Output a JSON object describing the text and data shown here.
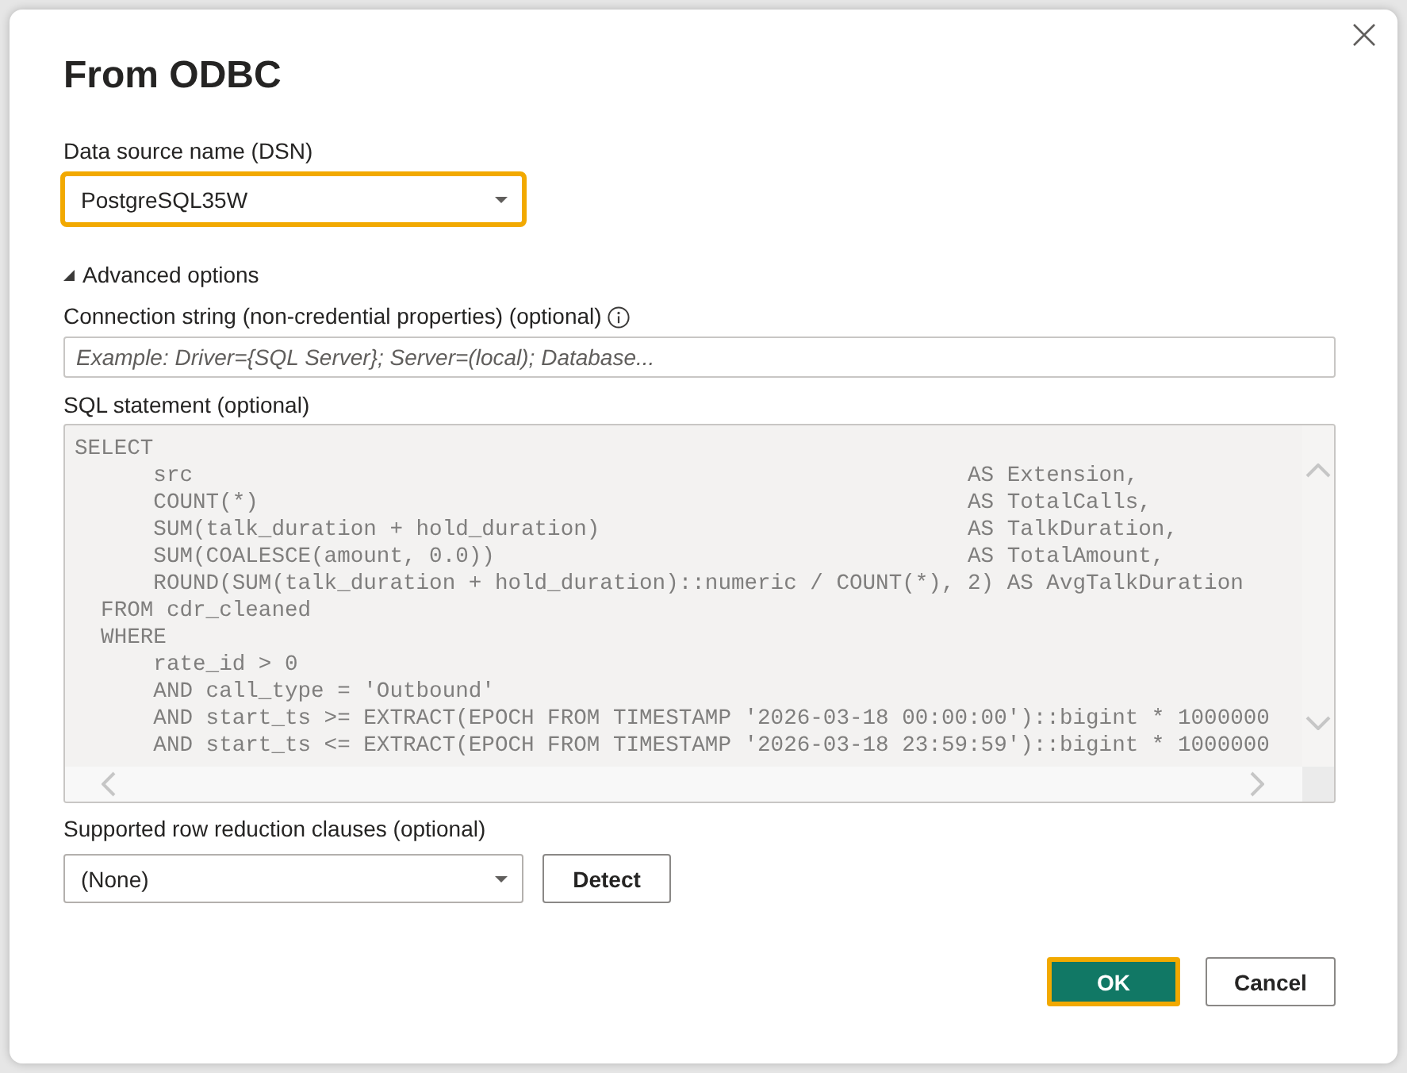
{
  "dialog": {
    "title": "From ODBC"
  },
  "dsn": {
    "label": "Data source name (DSN)",
    "value": "PostgreSQL35W",
    "highlighted": true
  },
  "advanced_options": {
    "label": "Advanced options",
    "expanded": true
  },
  "connection_string": {
    "label": "Connection string (non-credential properties) (optional)",
    "placeholder": "Example: Driver={SQL Server}; Server=(local); Database..."
  },
  "sql_statement": {
    "label": "SQL statement (optional)",
    "lines": [
      "SELECT",
      "      src                                                           AS Extension,",
      "      COUNT(*)                                                      AS TotalCalls,",
      "      SUM(talk_duration + hold_duration)                            AS TalkDuration,",
      "      SUM(COALESCE(amount, 0.0))                                    AS TotalAmount,",
      "      ROUND(SUM(talk_duration + hold_duration)::numeric / COUNT(*), 2) AS AvgTalkDuration",
      "  FROM cdr_cleaned",
      "  WHERE",
      "      rate_id > 0",
      "      AND call_type = 'Outbound'",
      "      AND start_ts >= EXTRACT(EPOCH FROM TIMESTAMP '2026-03-18 00:00:00')::bigint * 1000000",
      "      AND start_ts <= EXTRACT(EPOCH FROM TIMESTAMP '2026-03-18 23:59:59')::bigint * 1000000"
    ]
  },
  "row_reduction": {
    "label": "Supported row reduction clauses (optional)",
    "value": "(None)",
    "highlighted": false,
    "detect_button": {
      "label": "Detect",
      "highlighted": false
    }
  },
  "buttons": [
    {
      "label": "OK",
      "kind": "primary",
      "highlighted": true
    },
    {
      "label": "Cancel",
      "kind": "secondary",
      "highlighted": false
    }
  ]
}
